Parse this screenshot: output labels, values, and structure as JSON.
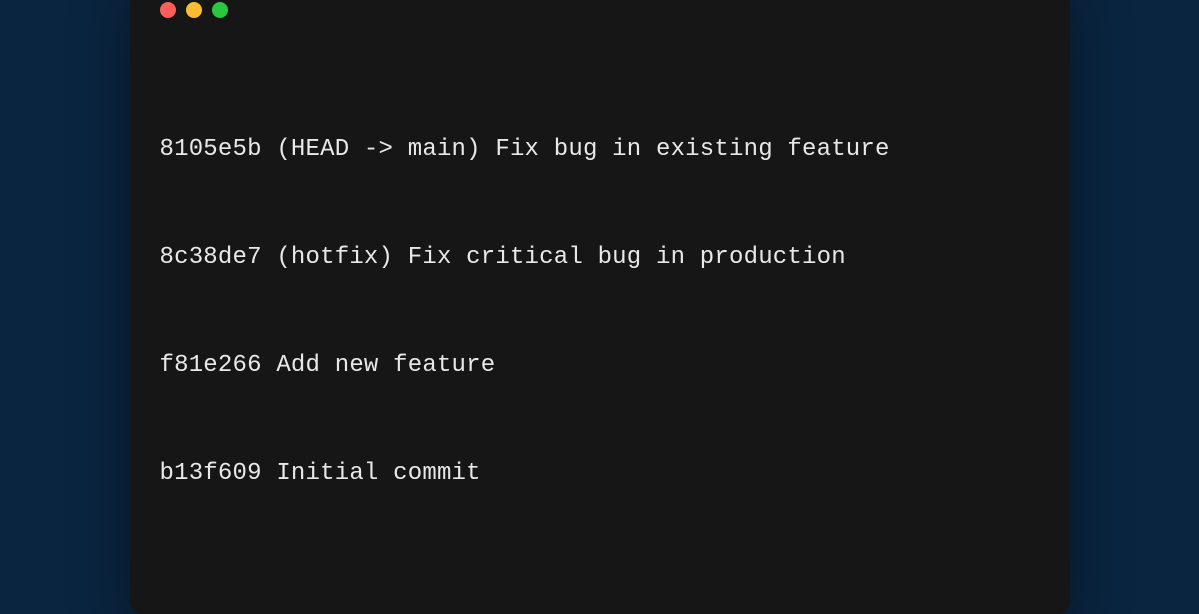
{
  "log_lines": [
    "8105e5b (HEAD -> main) Fix bug in existing feature",
    "8c38de7 (hotfix) Fix critical bug in production",
    "f81e266 Add new feature",
    "b13f609 Initial commit"
  ]
}
